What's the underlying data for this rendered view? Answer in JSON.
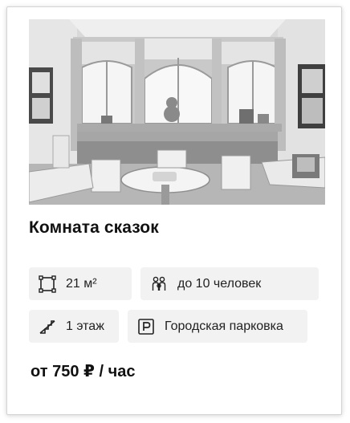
{
  "venue": {
    "title": "Комната сказок",
    "photo_alt": "Комната сказок",
    "features": [
      {
        "icon": "area-icon",
        "label": "21 м²"
      },
      {
        "icon": "people-icon",
        "label": "до 10 человек"
      },
      {
        "icon": "stairs-icon",
        "label": "1 этаж"
      },
      {
        "icon": "parking-icon",
        "label": "Городская парковка"
      }
    ],
    "price": "от 750 ₽ / час"
  }
}
